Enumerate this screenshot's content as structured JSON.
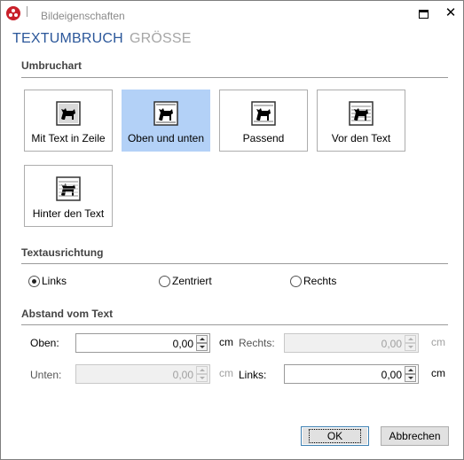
{
  "window": {
    "title": "Bildeigenschaften",
    "app_icon": "app-logo-icon",
    "maximize_icon": "maximize-icon",
    "close_glyph": "✕"
  },
  "tabs": [
    {
      "label": "TEXTUMBRUCH",
      "active": true
    },
    {
      "label": "GRÖSSE",
      "active": false
    }
  ],
  "wrap_section": {
    "title": "Umbruchart",
    "options": [
      {
        "label": "Mit Text in Zeile",
        "icon": "wrap-inline-icon",
        "selected": false
      },
      {
        "label": "Oben und unten",
        "icon": "wrap-top-bottom-icon",
        "selected": true
      },
      {
        "label": "Passend",
        "icon": "wrap-tight-icon",
        "selected": false
      },
      {
        "label": "Vor den Text",
        "icon": "wrap-in-front-icon",
        "selected": false
      },
      {
        "label": "Hinter den Text",
        "icon": "wrap-behind-icon",
        "selected": false
      }
    ]
  },
  "alignment_section": {
    "title": "Textausrichtung",
    "options": [
      {
        "label": "Links",
        "checked": true
      },
      {
        "label": "Zentriert",
        "checked": false
      },
      {
        "label": "Rechts",
        "checked": false
      }
    ]
  },
  "distance_section": {
    "title": "Abstand vom Text",
    "top": {
      "label": "Oben:",
      "value": "0,00",
      "unit": "cm",
      "enabled": true
    },
    "right": {
      "label": "Rechts:",
      "value": "0,00",
      "unit": "cm",
      "enabled": false
    },
    "bottom": {
      "label": "Unten:",
      "value": "0,00",
      "unit": "cm",
      "enabled": false
    },
    "left": {
      "label": "Links:",
      "value": "0,00",
      "unit": "cm",
      "enabled": true
    }
  },
  "buttons": {
    "ok": "OK",
    "cancel": "Abbrechen"
  },
  "colors": {
    "accent": "#2b579a",
    "selected_tile": "#b3d1f7",
    "inactive_tab": "#a6a6a6"
  }
}
